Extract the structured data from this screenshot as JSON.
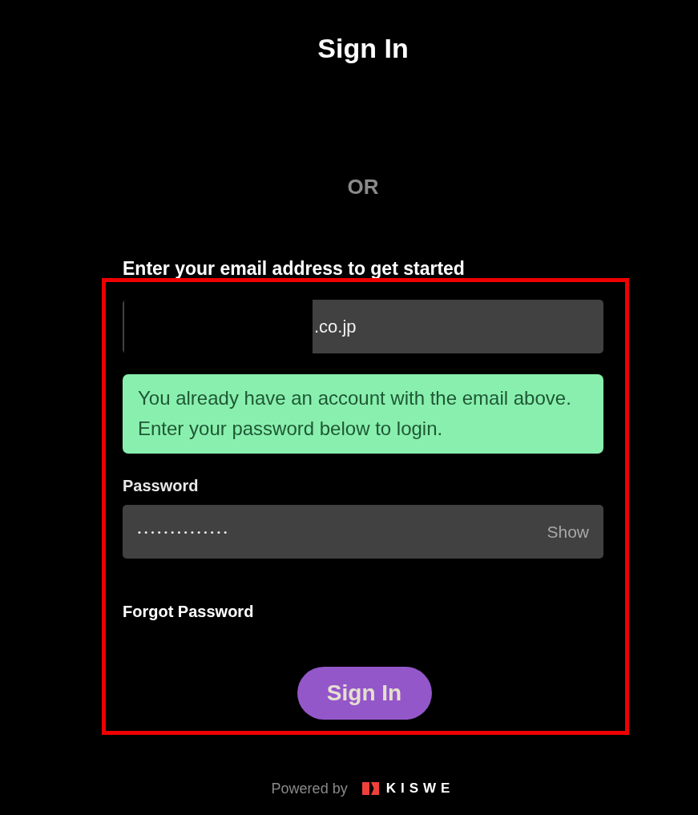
{
  "title": "Sign In",
  "divider": "OR",
  "email": {
    "label": "Enter your email address to get started",
    "value": ".co.jp"
  },
  "notice": {
    "text": "You already have an account with the email above. Enter your password below to login."
  },
  "password": {
    "label": "Password",
    "value": "••••••••••••••",
    "toggle": "Show"
  },
  "forgot_link": "Forgot Password",
  "submit": "Sign In",
  "footer": {
    "powered_by": "Powered by",
    "brand": "KISWE"
  }
}
